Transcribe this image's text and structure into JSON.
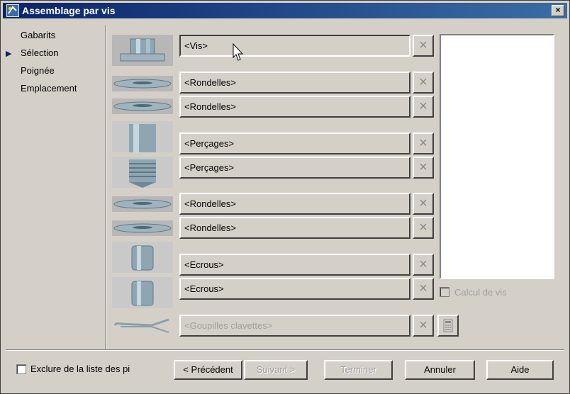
{
  "window": {
    "title": "Assemblage par vis",
    "close_label": "×"
  },
  "nav": {
    "items": [
      {
        "label": "Gabarits"
      },
      {
        "label": "Sélection"
      },
      {
        "label": "Poignée"
      },
      {
        "label": "Emplacement"
      }
    ],
    "current_marker": "▶"
  },
  "rows": [
    {
      "label": "<Vis>",
      "part_icon": "bolt-icon"
    },
    {
      "label": "<Rondelles>",
      "part_icon": "washer-icon"
    },
    {
      "label": "<Rondelles>",
      "part_icon": "washer-icon"
    },
    {
      "label": "<Perçages>",
      "part_icon": "hole-icon"
    },
    {
      "label": "<Perçages>",
      "part_icon": "threaded-hole-icon"
    },
    {
      "label": "<Rondelles>",
      "part_icon": "washer-icon"
    },
    {
      "label": "<Rondelles>",
      "part_icon": "washer-icon"
    },
    {
      "label": "<Ecrous>",
      "part_icon": "nut-icon"
    },
    {
      "label": "<Ecrous>",
      "part_icon": "nut-icon"
    },
    {
      "label": "<Goupilles clavettes>",
      "part_icon": "cotter-pin-icon",
      "disabled": true
    }
  ],
  "remove_icon": "×",
  "calcul": {
    "label": "Calcul de vis",
    "checked": false
  },
  "exclude": {
    "label": "Exclure de la liste des pièc",
    "checked": false
  },
  "buttons": {
    "previous": "< Précédent",
    "next": "Suivant >",
    "finish": "Terminer",
    "cancel": "Annuler",
    "help": "Aide"
  }
}
